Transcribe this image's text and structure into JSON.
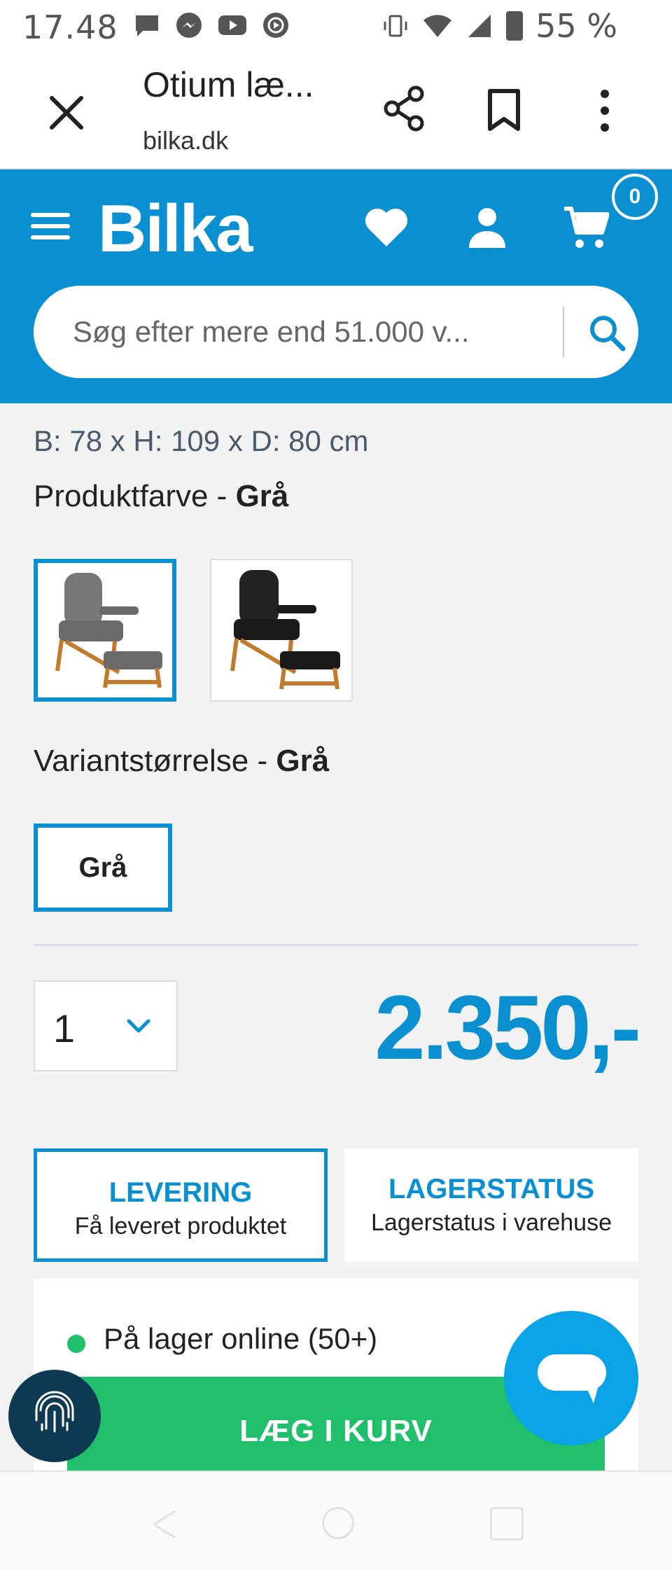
{
  "status_bar": {
    "time": "17.48",
    "battery": "55 %",
    "left_icons": [
      "message-icon",
      "messenger-icon",
      "youtube-icon",
      "youtube-music-icon"
    ],
    "right_icons": [
      "vibrate-icon",
      "wifi-icon",
      "signal-icon",
      "battery-icon"
    ]
  },
  "browser": {
    "title": "Otium læ...",
    "url": "bilka.dk"
  },
  "header": {
    "logo": "Bilka",
    "cart_count": "0",
    "search_placeholder": "Søg efter mere end 51.000 v..."
  },
  "product": {
    "dimensions": "B: 78 x H: 109 x D: 80 cm",
    "color_label": "Produktfarve - ",
    "color_value": "Grå",
    "size_label": "Variantstørrelse - ",
    "size_value": "Grå",
    "size_option": "Grå",
    "quantity": "1",
    "price": "2.350,-"
  },
  "tabs": [
    {
      "title": "LEVERING",
      "subtitle": "Få leveret produktet"
    },
    {
      "title": "LAGERSTATUS",
      "subtitle": "Lagerstatus i varehuse"
    }
  ],
  "stock": {
    "text": "På lager online (50+)"
  },
  "add_to_cart_label": "LÆG I KURV",
  "colors": {
    "brand_blue": "#0a90d0",
    "green": "#1fbf6c",
    "chat_blue": "#0aa3e6",
    "fingerprint_bg": "#0d3a52"
  }
}
